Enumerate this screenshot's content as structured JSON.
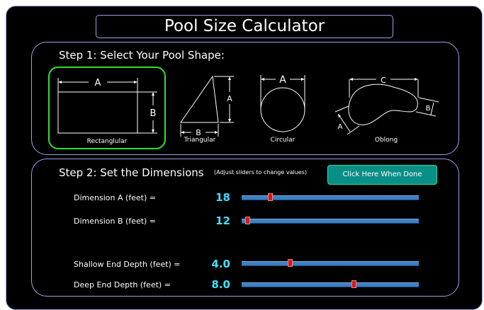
{
  "title": "Pool Size Calculator",
  "step1": {
    "heading": "Step 1:  Select Your Pool Shape:",
    "selected": "Rectanglular",
    "shapes": [
      {
        "label": "Rectanglular",
        "dims": [
          "A",
          "B"
        ]
      },
      {
        "label": "Triangular",
        "dims": [
          "A",
          "B"
        ]
      },
      {
        "label": "Circular",
        "dims": [
          "A"
        ]
      },
      {
        "label": "Oblong",
        "dims": [
          "C",
          "B",
          "A"
        ]
      }
    ]
  },
  "step2": {
    "heading": "Step 2:  Set the Dimensions",
    "note": "(Adjust sliders to change values)",
    "done_button": "Click Here When Done",
    "rows": [
      {
        "label": "Dimension A (feet)  =",
        "value": "18",
        "fraction": 0.16
      },
      {
        "label": "Dimension B (feet)  =",
        "value": "12",
        "fraction": 0.03
      },
      {
        "label": "Shallow End Depth (feet)  =",
        "value": "4.0",
        "fraction": 0.27
      },
      {
        "label": "Deep End Depth (feet)  =",
        "value": "8.0",
        "fraction": 0.63
      }
    ]
  },
  "colors": {
    "accent_green": "#2ee02e",
    "value_cyan": "#3fe0ff",
    "thumb_red": "#d21a1a",
    "button_teal": "#0a8f86"
  }
}
